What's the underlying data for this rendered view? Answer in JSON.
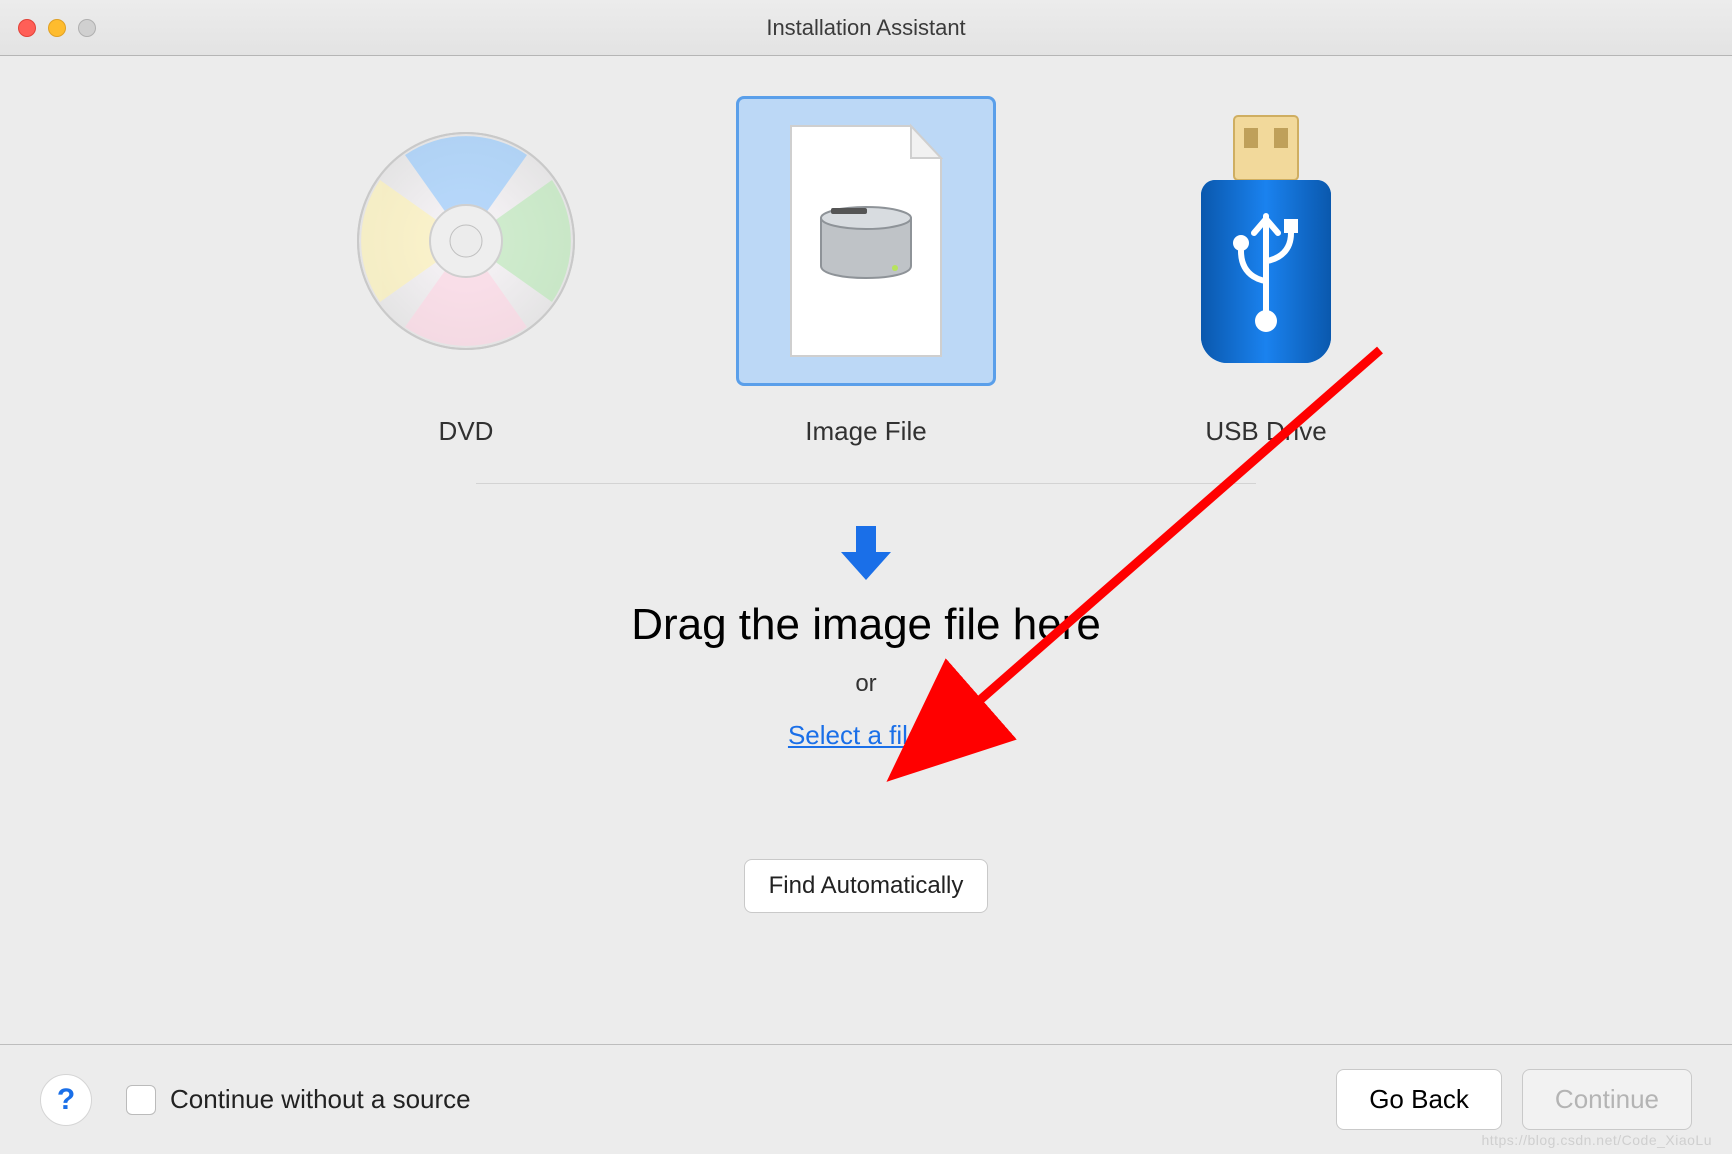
{
  "window": {
    "title": "Installation Assistant"
  },
  "sources": {
    "dvd": {
      "label": "DVD"
    },
    "image": {
      "label": "Image File"
    },
    "usb": {
      "label": "USB Drive"
    }
  },
  "drop": {
    "instruction": "Drag the image file here",
    "or": "or",
    "select_link": "Select a file..."
  },
  "buttons": {
    "find_auto": "Find Automatically",
    "go_back": "Go Back",
    "continue": "Continue"
  },
  "bottom": {
    "continue_without": "Continue without a source"
  },
  "watermark": "https://blog.csdn.net/Code_XiaoLu"
}
